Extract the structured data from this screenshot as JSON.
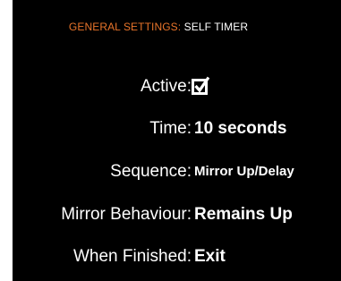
{
  "header": {
    "category": "GENERAL SETTINGS:",
    "page": "SELF TIMER"
  },
  "settings": {
    "active": {
      "label": "Active:",
      "checked": true,
      "icon": "checkbox-checked-icon"
    },
    "time": {
      "label": "Time:",
      "value": "10 seconds"
    },
    "sequence": {
      "label": "Sequence:",
      "value": "Mirror Up/Delay"
    },
    "mirror_behaviour": {
      "label": "Mirror Behaviour:",
      "value": "Remains Up"
    },
    "when_finished": {
      "label": "When Finished:",
      "value": "Exit"
    }
  },
  "colors": {
    "background": "#000000",
    "text": "#ffffff",
    "accent": "#e8742a"
  }
}
